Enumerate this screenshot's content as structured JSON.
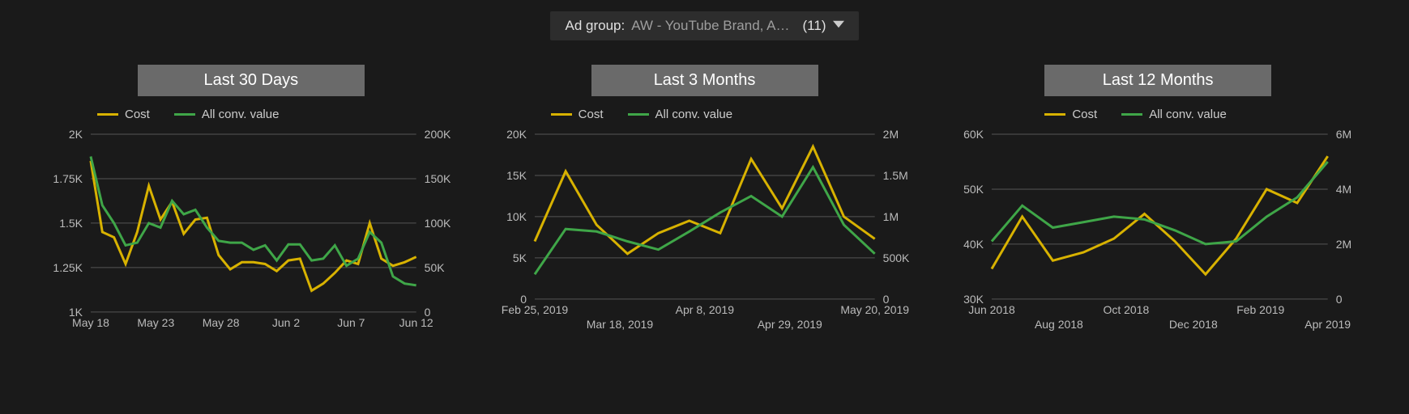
{
  "filter": {
    "label": "Ad group",
    "value": "AW - YouTube Brand, A…",
    "count": "(11)"
  },
  "legend": {
    "cost": "Cost",
    "conv": "All conv. value"
  },
  "panel_titles": {
    "p30": "Last 30 Days",
    "p3m": "Last 3 Months",
    "p12m": "Last 12  Months"
  },
  "colors": {
    "cost": "#d8b200",
    "conv": "#3fa648",
    "grid": "#555555",
    "bg": "#1a1a1a",
    "title_bg": "#6a6a6a"
  },
  "chart_data": [
    {
      "id": "last30",
      "title": "Last 30 Days",
      "type": "line",
      "x_labels": [
        "May 18",
        "May 23",
        "May 28",
        "Jun 2",
        "Jun 7",
        "Jun 12"
      ],
      "y_left": {
        "label": "Cost",
        "min": 1000,
        "max": 2000,
        "ticks": [
          1000,
          1250,
          1500,
          1750,
          2000
        ],
        "tick_labels": [
          "1K",
          "1.25K",
          "1.5K",
          "1.75K",
          "2K"
        ]
      },
      "y_right": {
        "label": "All conv. value",
        "min": 0,
        "max": 200000,
        "ticks": [
          0,
          50000,
          100000,
          150000,
          200000
        ],
        "tick_labels": [
          "0",
          "50K",
          "100K",
          "150K",
          "200K"
        ]
      },
      "series": [
        {
          "name": "Cost",
          "axis": "left",
          "color": "#d8b200",
          "values": [
            1850,
            1450,
            1420,
            1270,
            1450,
            1710,
            1520,
            1620,
            1440,
            1520,
            1530,
            1320,
            1240,
            1280,
            1280,
            1270,
            1230,
            1290,
            1300,
            1120,
            1160,
            1220,
            1290,
            1270,
            1500,
            1300,
            1260,
            1280,
            1310
          ]
        },
        {
          "name": "All conv. value",
          "axis": "right",
          "color": "#3fa648",
          "values": [
            175000,
            120000,
            100000,
            75000,
            78000,
            100000,
            95000,
            125000,
            110000,
            115000,
            95000,
            80000,
            78000,
            78000,
            70000,
            75000,
            58000,
            76000,
            76000,
            58000,
            60000,
            75000,
            52000,
            60000,
            90000,
            78000,
            40000,
            32000,
            30000
          ]
        }
      ]
    },
    {
      "id": "last3m",
      "title": "Last 3 Months",
      "type": "line",
      "x_labels": [
        "Feb 25, 2019",
        "Mar 18, 2019",
        "Apr 8, 2019",
        "Apr 29, 2019",
        "May 20, 2019"
      ],
      "y_left": {
        "label": "Cost",
        "min": 0,
        "max": 20000,
        "ticks": [
          0,
          5000,
          10000,
          15000,
          20000
        ],
        "tick_labels": [
          "0",
          "5K",
          "10K",
          "15K",
          "20K"
        ]
      },
      "y_right": {
        "label": "All conv. value",
        "min": 0,
        "max": 2000000,
        "ticks": [
          0,
          500000,
          1000000,
          1500000,
          2000000
        ],
        "tick_labels": [
          "0",
          "500K",
          "1M",
          "1.5M",
          "2M"
        ]
      },
      "series": [
        {
          "name": "Cost",
          "axis": "left",
          "color": "#d8b200",
          "values": [
            7000,
            15500,
            9000,
            5500,
            8000,
            9500,
            8000,
            17000,
            11000,
            18500,
            10000,
            7300
          ]
        },
        {
          "name": "All conv. value",
          "axis": "right",
          "color": "#3fa648",
          "values": [
            300000,
            850000,
            820000,
            700000,
            600000,
            820000,
            1050000,
            1250000,
            1000000,
            1600000,
            900000,
            550000
          ]
        }
      ]
    },
    {
      "id": "last12m",
      "title": "Last 12  Months",
      "type": "line",
      "x_labels": [
        "Jun 2018",
        "Aug 2018",
        "Oct 2018",
        "Dec 2018",
        "Feb 2019",
        "Apr 2019"
      ],
      "y_left": {
        "label": "Cost",
        "min": 30000,
        "max": 60000,
        "ticks": [
          30000,
          40000,
          50000,
          60000
        ],
        "tick_labels": [
          "30K",
          "40K",
          "50K",
          "60K"
        ]
      },
      "y_right": {
        "label": "All conv. value",
        "min": 0,
        "max": 6000000,
        "ticks": [
          0,
          2000000,
          4000000,
          6000000
        ],
        "tick_labels": [
          "0",
          "2M",
          "4M",
          "6M"
        ]
      },
      "series": [
        {
          "name": "Cost",
          "axis": "left",
          "color": "#d8b200",
          "values": [
            35500,
            45000,
            37000,
            38500,
            41000,
            45500,
            40500,
            34500,
            41000,
            50000,
            47500,
            56000
          ]
        },
        {
          "name": "All conv. value",
          "axis": "right",
          "color": "#3fa648",
          "values": [
            2100000,
            3400000,
            2600000,
            2800000,
            3000000,
            2900000,
            2500000,
            2000000,
            2100000,
            3000000,
            3700000,
            5000000
          ]
        }
      ]
    }
  ]
}
